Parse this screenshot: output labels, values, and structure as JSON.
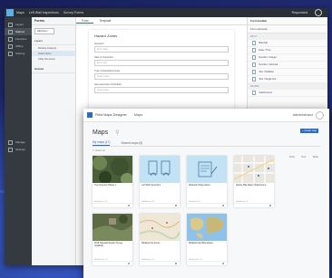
{
  "back_window": {
    "topbar": {
      "items": [
        "Maps",
        "Left Wall Inspections",
        "Survey Forms"
      ],
      "right": "Requested"
    },
    "nav": [
      "Layers",
      "Starred",
      "Favorites",
      "Offline",
      "Sharing",
      "Manage",
      "Settings"
    ],
    "tree": {
      "header": "Forms",
      "button": "Add Form",
      "groups": [
        {
          "label": "Layers",
          "items": [
            {
              "label": "Building Features",
              "selected": false
            },
            {
              "label": "Indoor Items",
              "selected": true
            },
            {
              "label": "Utility Structures",
              "selected": false
            }
          ]
        },
        {
          "label": "Related",
          "items": []
        }
      ]
    },
    "form": {
      "tabs": [
        "Form",
        "Template"
      ],
      "title": "Hazard Zones",
      "fields": [
        {
          "label": "Inspector",
          "placeholder": "Enter value"
        },
        {
          "label": "Date of Inspection",
          "placeholder": "Enter date"
        },
        {
          "label": "Type of Hazardous Area",
          "placeholder": "Select value"
        },
        {
          "label": "Has Area been Controlled",
          "placeholder": "Select value"
        }
      ]
    },
    "elements": {
      "header": "Form builder",
      "subheader": "Form elements",
      "sections": [
        {
          "label": "INPUT",
          "items": [
            "Barcode",
            "Date / Time",
            "Number / Integer",
            "Number / Decimal",
            "Text / Multiline",
            "Text / Single line"
          ]
        },
        {
          "label": "INFORM",
          "items": [
            "Attachments"
          ]
        }
      ]
    }
  },
  "front_window": {
    "app_name": "Field Maps Designer",
    "nav_label": "Maps",
    "user_label": "Administrator",
    "page_title": "Maps",
    "new_button": "+ Create map",
    "tabs": [
      {
        "label": "My maps (17)",
        "active": true
      },
      {
        "label": "Shared maps (5)",
        "active": false
      }
    ],
    "tools": [
      "Filter",
      "Sort",
      "Table"
    ],
    "select_all": "Select all",
    "maps": [
      {
        "title": "Tree Inventory Phase 1",
        "meta": "Modified Jan 12",
        "thumb": "forest"
      },
      {
        "title": "Left Wall Inspections",
        "meta": "Modified Jan 10",
        "thumb": "form-sketch"
      },
      {
        "title": "Wetlands Observations",
        "meta": "Modified Jan 9",
        "thumb": "form-sketch-alt"
      },
      {
        "title": "Square Mile Water Infrastructure",
        "meta": "Modified Jan 5",
        "thumb": "city-map"
      },
      {
        "title": "2019 Sidewalk Repairs Survey (Oakfield)",
        "meta": "Modified Dec 20",
        "thumb": "aerial"
      },
      {
        "title": "Wildland Fire Zones",
        "meta": "Modified Dec 18",
        "thumb": "terrain"
      },
      {
        "title": "Wildland Field Boundaries",
        "meta": "Modified Dec 14",
        "thumb": "world-map"
      }
    ]
  }
}
